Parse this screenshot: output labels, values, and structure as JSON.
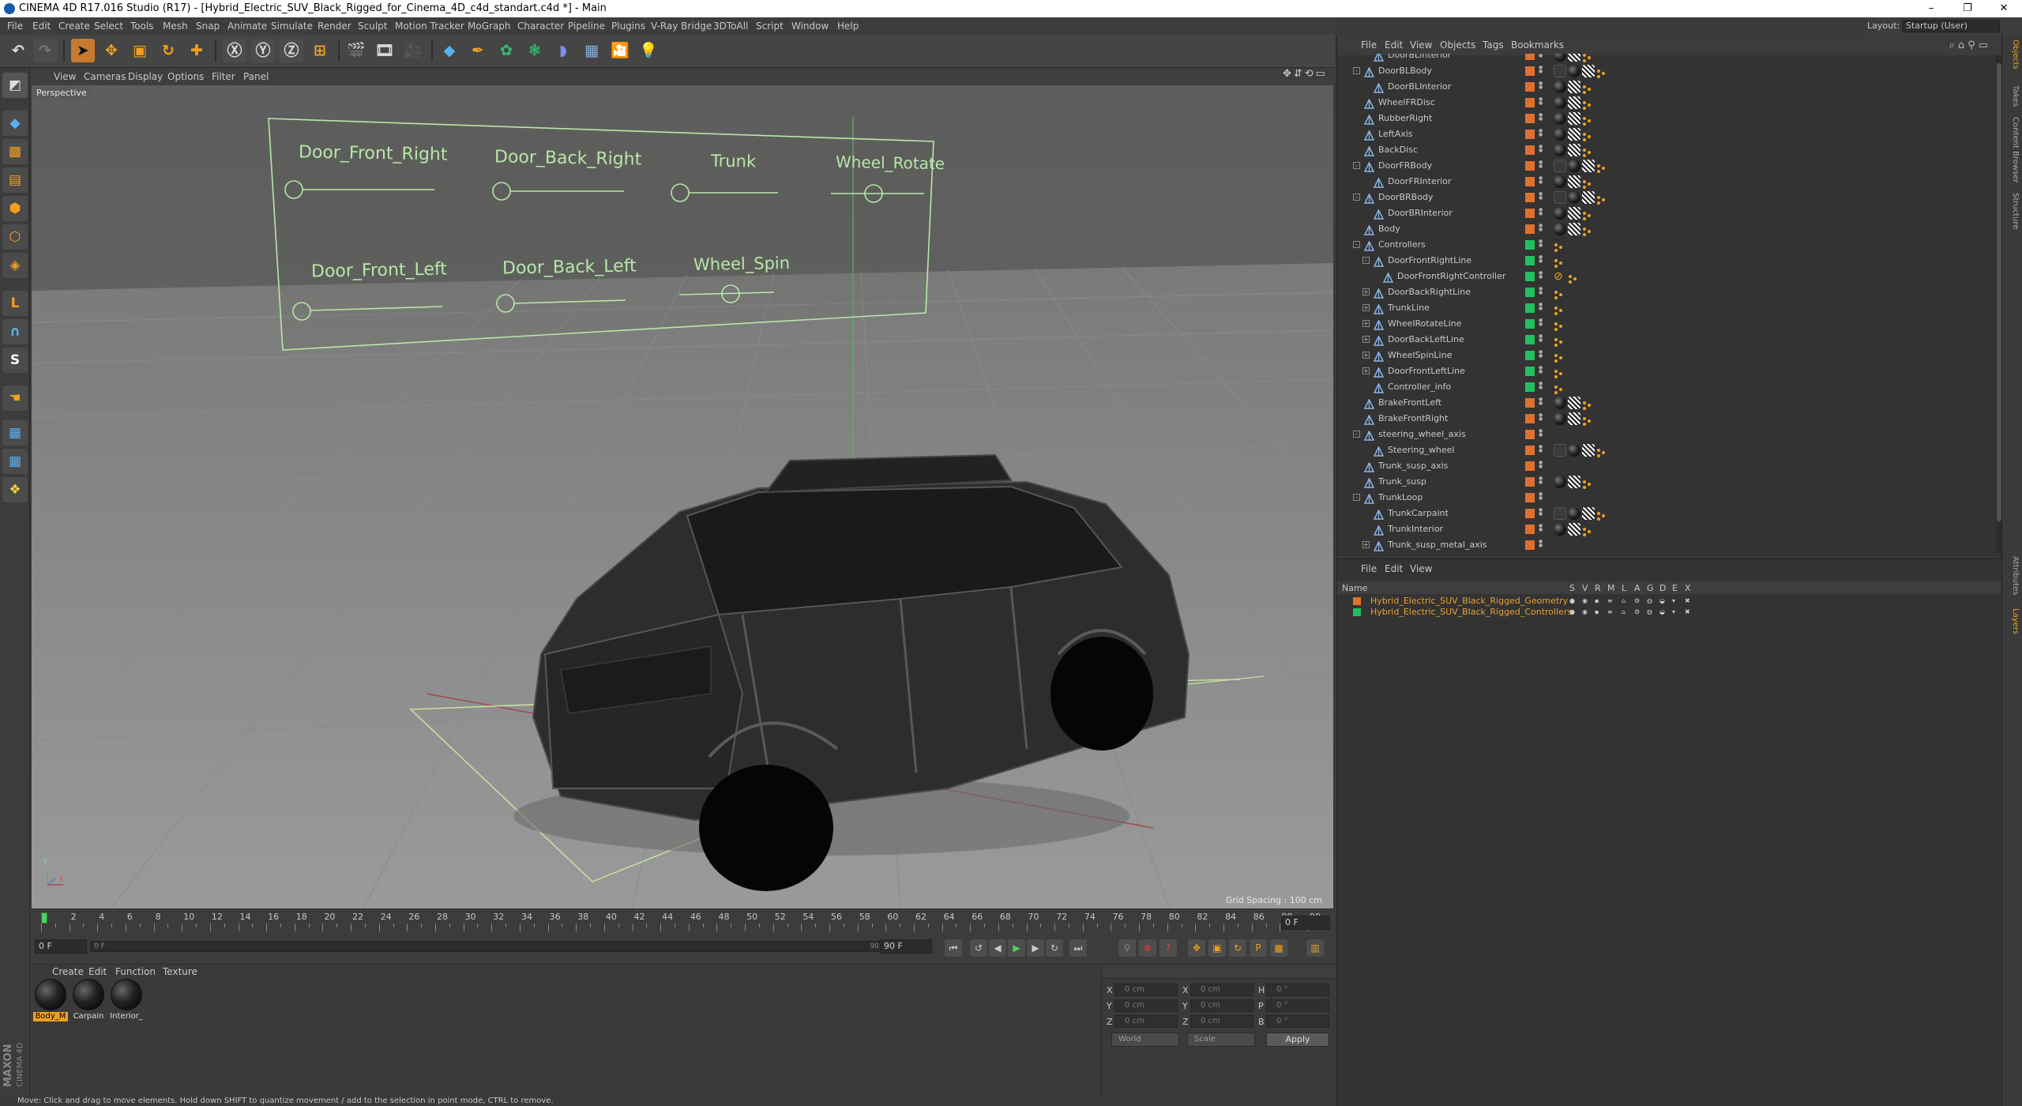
{
  "window": {
    "title": "CINEMA 4D R17.016 Studio (R17) - [Hybrid_Electric_SUV_Black_Rigged_for_Cinema_4D_c4d_standart.c4d *] - Main",
    "min": "–",
    "max": "❐",
    "close": "✕"
  },
  "menubar": [
    "File",
    "Edit",
    "Create",
    "Select",
    "Tools",
    "Mesh",
    "Snap",
    "Animate",
    "Simulate",
    "Render",
    "Sculpt",
    "Motion Tracker",
    "MoGraph",
    "Character",
    "Pipeline",
    "Plugins",
    "V-Ray Bridge",
    "3DToAll",
    "Script",
    "Window",
    "Help"
  ],
  "layout": {
    "label": "Layout:",
    "value": "Startup (User)"
  },
  "viewport": {
    "menu": [
      "View",
      "Cameras",
      "Display",
      "Options",
      "Filter",
      "Panel"
    ],
    "camera": "Perspective",
    "grid_spacing": "Grid Spacing : 100 cm",
    "controls_top": [
      "Door_Front_Right",
      "Door_Back_Right",
      "Trunk",
      "Wheel_Rotate"
    ],
    "controls_bottom": [
      "Door_Front_Left",
      "Door_Back_Left",
      "Wheel_Spin"
    ],
    "axis_y": "Y",
    "axis_x": "X"
  },
  "timeline": {
    "ticks": [
      "0",
      "2",
      "4",
      "6",
      "8",
      "10",
      "12",
      "14",
      "16",
      "18",
      "20",
      "22",
      "24",
      "26",
      "28",
      "30",
      "32",
      "34",
      "36",
      "38",
      "40",
      "42",
      "44",
      "46",
      "48",
      "50",
      "52",
      "54",
      "56",
      "58",
      "60",
      "62",
      "64",
      "66",
      "68",
      "70",
      "72",
      "74",
      "76",
      "78",
      "80",
      "82",
      "84",
      "86",
      "88",
      "90"
    ],
    "current_frame": "0 F",
    "start_field": "0 F",
    "range_start": "0 F",
    "range_end": "90 F",
    "end_field": "90 F"
  },
  "materials": {
    "menu": [
      "Create",
      "Edit",
      "Function",
      "Texture"
    ],
    "items": [
      "Body_M",
      "Carpain",
      "Interior_"
    ]
  },
  "coords": {
    "x_pos": "0 cm",
    "y_pos": "0 cm",
    "z_pos": "0 cm",
    "x_size": "0 cm",
    "y_size": "0 cm",
    "z_size": "0 cm",
    "h": "0 °",
    "p": "0 °",
    "b": "0 °",
    "labels": [
      "X",
      "Y",
      "Z",
      "X",
      "Y",
      "Z",
      "H",
      "P",
      "B"
    ],
    "mode": "World",
    "size_mode": "Scale",
    "apply": "Apply"
  },
  "status": "Move: Click and drag to move elements. Hold down SHIFT to quantize movement / add to the selection in point mode, CTRL to remove.",
  "object_manager": {
    "menu": [
      "File",
      "Edit",
      "View",
      "Objects",
      "Tags",
      "Bookmarks"
    ],
    "rows": [
      {
        "name": "DoorBLInterior",
        "level": 2,
        "layer": "#e07030",
        "tw": "",
        "tags": [
          "mat",
          "chk",
          "dots"
        ]
      },
      {
        "name": "DoorBLBody",
        "level": 1,
        "layer": "#e07030",
        "tw": "-",
        "tags": [
          "ph",
          "mat",
          "chk",
          "dots"
        ]
      },
      {
        "name": "DoorBLInterior",
        "level": 2,
        "layer": "#e07030",
        "tw": "",
        "tags": [
          "mat",
          "chk",
          "dots"
        ]
      },
      {
        "name": "WheelFRDisc",
        "level": 1,
        "layer": "#e07030",
        "tw": "",
        "tags": [
          "mat",
          "chk",
          "dots"
        ]
      },
      {
        "name": "RubberRight",
        "level": 1,
        "layer": "#e07030",
        "tw": "",
        "tags": [
          "mat",
          "chk",
          "dots"
        ]
      },
      {
        "name": "LeftAxis",
        "level": 1,
        "layer": "#e07030",
        "tw": "",
        "tags": [
          "mat",
          "chk",
          "dots"
        ]
      },
      {
        "name": "BackDisc",
        "level": 1,
        "layer": "#e07030",
        "tw": "",
        "tags": [
          "mat",
          "chk",
          "dots"
        ]
      },
      {
        "name": "DoorFRBody",
        "level": 1,
        "layer": "#e07030",
        "tw": "-",
        "tags": [
          "ph",
          "mat",
          "chk",
          "dots"
        ]
      },
      {
        "name": "DoorFRInterior",
        "level": 2,
        "layer": "#e07030",
        "tw": "",
        "tags": [
          "mat",
          "chk",
          "dots"
        ]
      },
      {
        "name": "DoorBRBody",
        "level": 1,
        "layer": "#e07030",
        "tw": "-",
        "tags": [
          "ph",
          "mat",
          "chk",
          "dots"
        ]
      },
      {
        "name": "DoorBRInterior",
        "level": 2,
        "layer": "#e07030",
        "tw": "",
        "tags": [
          "mat",
          "chk",
          "dots"
        ]
      },
      {
        "name": "Body",
        "level": 1,
        "layer": "#e07030",
        "tw": "",
        "tags": [
          "mat",
          "chk",
          "dots"
        ]
      },
      {
        "name": "Controllers",
        "level": 1,
        "layer": "#20c060",
        "tw": "-",
        "tags": [
          "dots"
        ]
      },
      {
        "name": "DoorFrontRightLine",
        "level": 2,
        "layer": "#20c060",
        "tw": "-",
        "tags": [
          "dots"
        ]
      },
      {
        "name": "DoorFrontRightController",
        "level": 3,
        "layer": "#20c060",
        "tw": "",
        "tags": [
          "no",
          "dots"
        ]
      },
      {
        "name": "DoorBackRightLine",
        "level": 2,
        "layer": "#20c060",
        "tw": "+",
        "tags": [
          "dots"
        ]
      },
      {
        "name": "TrunkLine",
        "level": 2,
        "layer": "#20c060",
        "tw": "+",
        "tags": [
          "dots"
        ]
      },
      {
        "name": "WheelRotateLine",
        "level": 2,
        "layer": "#20c060",
        "tw": "+",
        "tags": [
          "dots"
        ]
      },
      {
        "name": "DoorBackLeftLine",
        "level": 2,
        "layer": "#20c060",
        "tw": "+",
        "tags": [
          "dots"
        ]
      },
      {
        "name": "WheelSpinLine",
        "level": 2,
        "layer": "#20c060",
        "tw": "+",
        "tags": [
          "dots"
        ]
      },
      {
        "name": "DoorFrontLeftLine",
        "level": 2,
        "layer": "#20c060",
        "tw": "+",
        "tags": [
          "dots"
        ]
      },
      {
        "name": "Controller_info",
        "level": 2,
        "layer": "#20c060",
        "tw": "",
        "tags": [
          "dots"
        ]
      },
      {
        "name": "BrakeFrontLeft",
        "level": 1,
        "layer": "#e07030",
        "tw": "",
        "tags": [
          "mat",
          "chk",
          "dots"
        ]
      },
      {
        "name": "BrakeFrontRight",
        "level": 1,
        "layer": "#e07030",
        "tw": "",
        "tags": [
          "mat",
          "chk",
          "dots"
        ]
      },
      {
        "name": "steering_wheel_axis",
        "level": 1,
        "layer": "#e07030",
        "tw": "-",
        "tags": []
      },
      {
        "name": "Steering_wheel",
        "level": 2,
        "layer": "#e07030",
        "tw": "",
        "tags": [
          "ph",
          "mat",
          "chk",
          "dots"
        ]
      },
      {
        "name": "Trunk_susp_axis",
        "level": 1,
        "layer": "#e07030",
        "tw": "",
        "tags": []
      },
      {
        "name": "Trunk_susp",
        "level": 1,
        "layer": "#e07030",
        "tw": "",
        "tags": [
          "mat",
          "chk",
          "dots"
        ]
      },
      {
        "name": "TrunkLoop",
        "level": 1,
        "layer": "#e07030",
        "tw": "-",
        "tags": []
      },
      {
        "name": "TrunkCarpaint",
        "level": 2,
        "layer": "#e07030",
        "tw": "",
        "tags": [
          "ph",
          "mat",
          "chk",
          "dots"
        ]
      },
      {
        "name": "TrunkInterior",
        "level": 2,
        "layer": "#e07030",
        "tw": "",
        "tags": [
          "mat",
          "chk",
          "dots"
        ]
      },
      {
        "name": "Trunk_susp_metal_axis",
        "level": 2,
        "layer": "#e07030",
        "tw": "+",
        "tags": []
      }
    ]
  },
  "layer_manager": {
    "menu": [
      "File",
      "Edit",
      "View"
    ],
    "columns": [
      "Name",
      "S",
      "V",
      "R",
      "M",
      "L",
      "A",
      "G",
      "D",
      "E",
      "X"
    ],
    "layers": [
      {
        "name": "Hybrid_Electric_SUV_Black_Rigged_Geometry",
        "color": "#e07030"
      },
      {
        "name": "Hybrid_Electric_SUV_Black_Rigged_Controllers",
        "color": "#20c060"
      }
    ]
  },
  "right_tabs": [
    "Objects",
    "Takes",
    "Content Browser",
    "Structure",
    "Attributes",
    "Layers"
  ],
  "colors": {
    "accent": "#f0a020",
    "ctrl_green": "#b8e6a8",
    "geo_layer": "#e07030",
    "ctrl_layer": "#20c060"
  }
}
